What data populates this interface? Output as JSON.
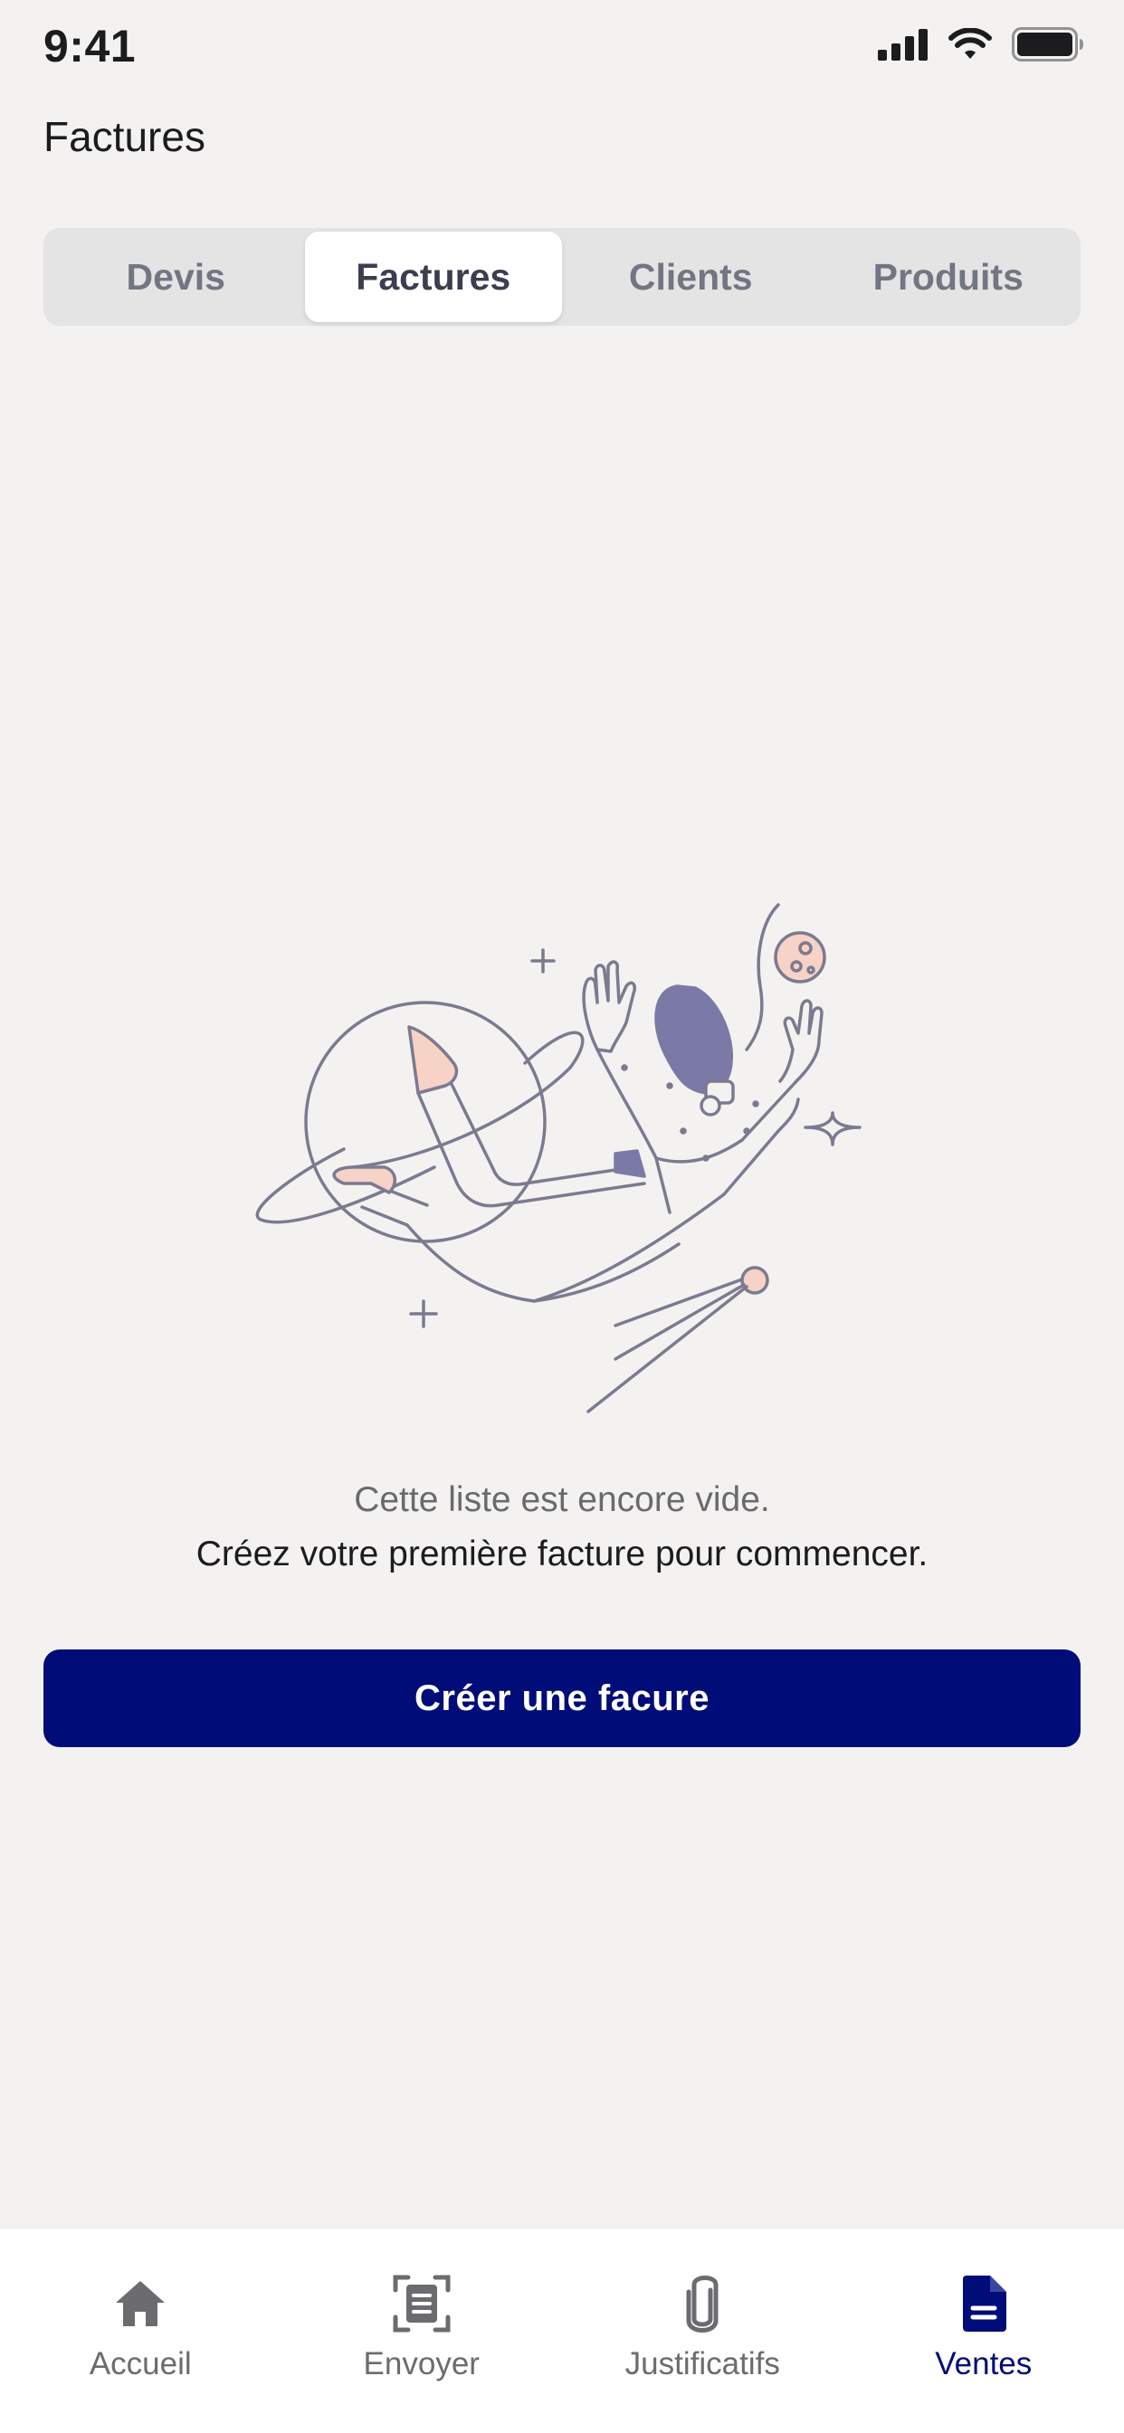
{
  "status_bar": {
    "time": "9:41"
  },
  "header": {
    "title": "Factures"
  },
  "segments": [
    {
      "label": "Devis",
      "active": false
    },
    {
      "label": "Factures",
      "active": true
    },
    {
      "label": "Clients",
      "active": false
    },
    {
      "label": "Produits",
      "active": false
    }
  ],
  "empty_state": {
    "line1": "Cette liste est encore vide.",
    "line2": "Créez votre première facture pour commencer."
  },
  "primary_action": {
    "label": "Créer une facure"
  },
  "tab_bar": {
    "items": [
      {
        "label": "Accueil",
        "icon": "home-icon",
        "active": false
      },
      {
        "label": "Envoyer",
        "icon": "scan-document-icon",
        "active": false
      },
      {
        "label": "Justificatifs",
        "icon": "paperclip-icon",
        "active": false
      },
      {
        "label": "Ventes",
        "icon": "invoice-document-icon",
        "active": true
      }
    ]
  },
  "colors": {
    "background": "#f3f2f1",
    "accent": "#000c78",
    "segment_track": "#e4e4e5",
    "inactive_text": "#727582",
    "illustration_line": "#7c7a8e",
    "illustration_hair": "#7b7aa6",
    "illustration_skin": "#f6d2c7"
  }
}
